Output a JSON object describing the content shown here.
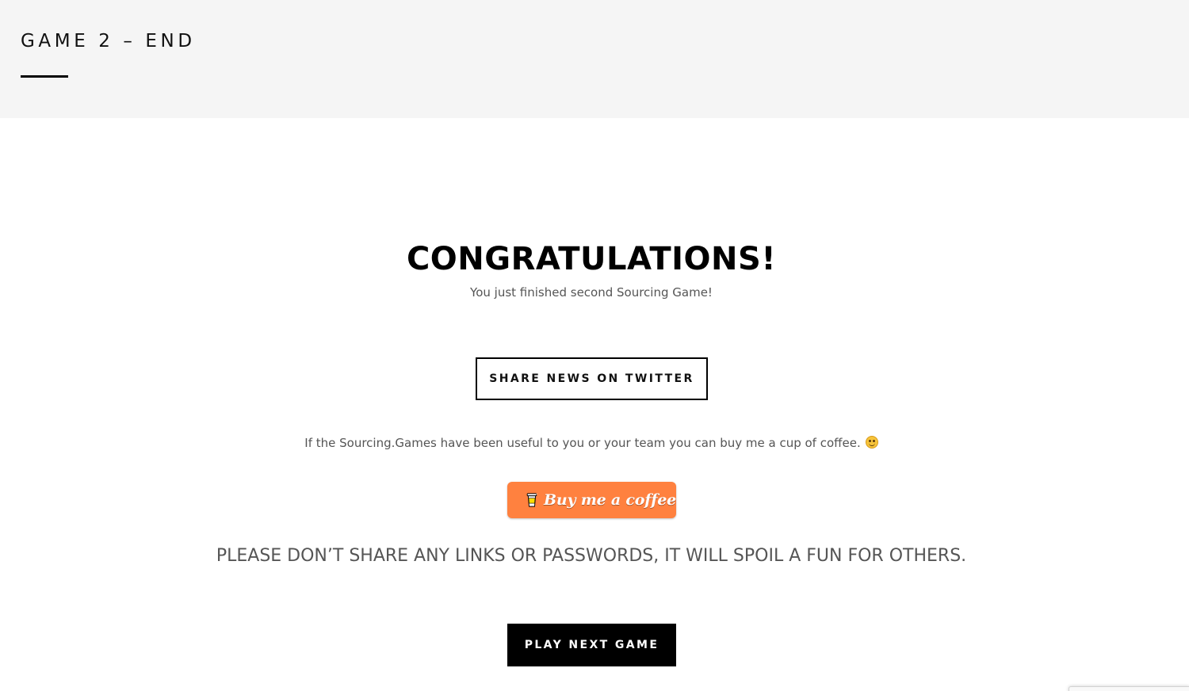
{
  "header": {
    "title": "GAME 2 – END"
  },
  "main": {
    "headline": "CONGRATULATIONS!",
    "subline": "You just finished second Sourcing Game!",
    "twitter_button_label": "SHARE NEWS ON TWITTER",
    "coffee_text": "If the Sourcing.Games have been useful to you or your team you can buy me a cup of coffee.",
    "coffee_emoji_icon": "smile-icon",
    "bmc_button_label": "Buy me a coffee",
    "warning": "PLEASE DON’T SHARE ANY LINKS OR PASSWORDS, IT WILL SPOIL A FUN FOR OTHERS.",
    "next_button_label": "PLAY NEXT GAME"
  },
  "colors": {
    "header_background": "#f5f5f5",
    "text_primary": "#000000",
    "text_secondary": "#555555",
    "bmc_orange": "#ff813f",
    "next_button_background": "#000000"
  }
}
